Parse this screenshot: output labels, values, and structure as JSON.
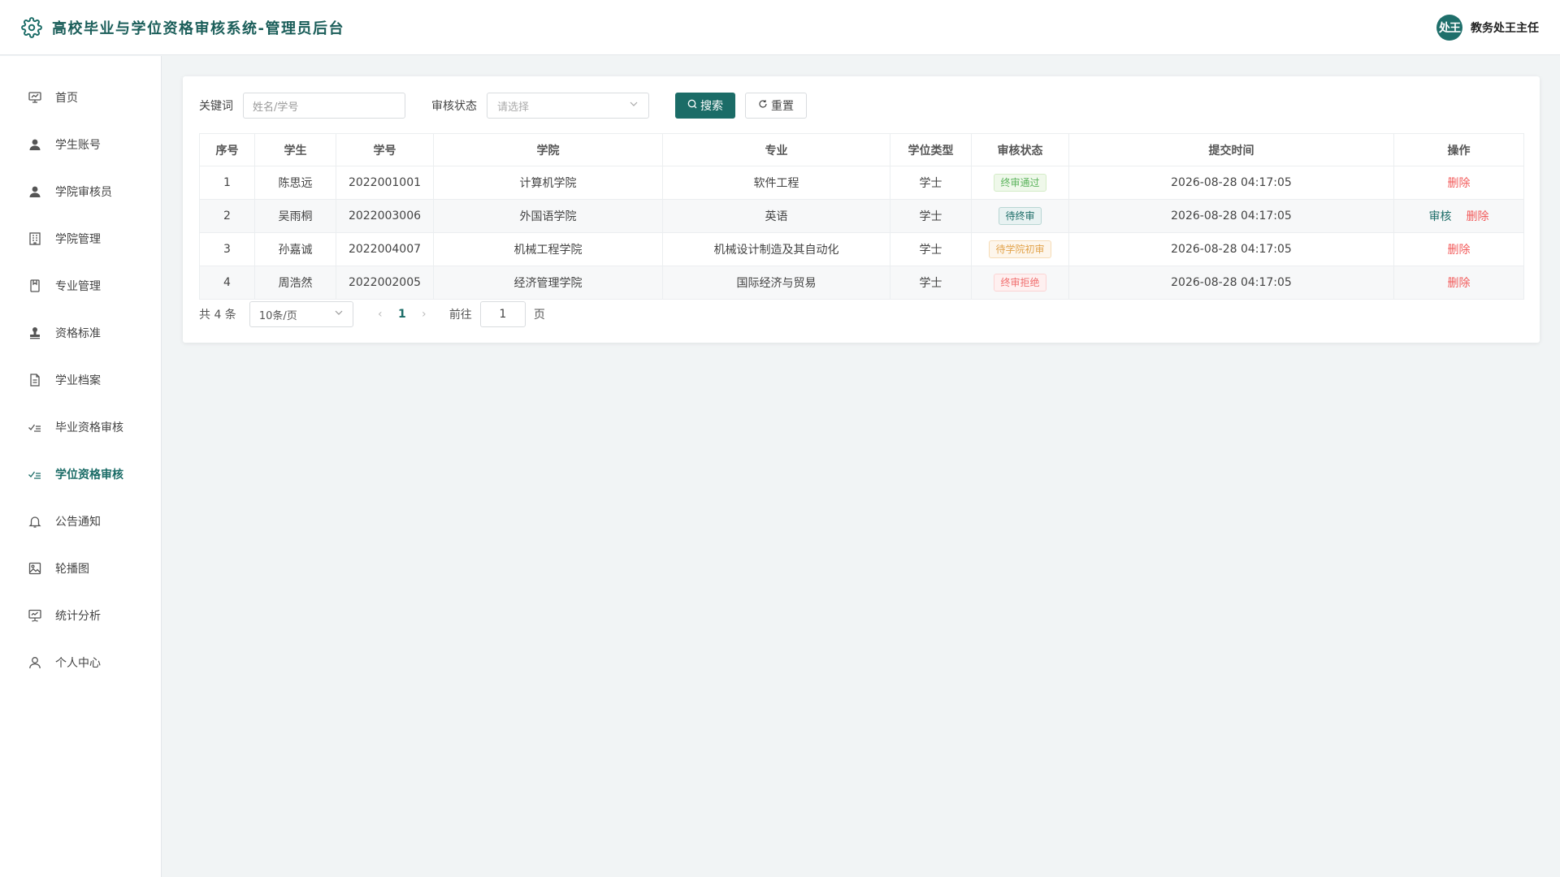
{
  "header": {
    "title": "高校毕业与学位资格审核系统-管理员后台",
    "avatar_text": "处王",
    "user_name": "教务处王主任"
  },
  "sidebar": {
    "items": [
      {
        "label": "首页",
        "icon": "monitor-icon"
      },
      {
        "label": "学生账号",
        "icon": "user-icon"
      },
      {
        "label": "学院审核员",
        "icon": "user-icon"
      },
      {
        "label": "学院管理",
        "icon": "building-icon"
      },
      {
        "label": "专业管理",
        "icon": "box-icon"
      },
      {
        "label": "资格标准",
        "icon": "stamp-icon"
      },
      {
        "label": "学业档案",
        "icon": "document-icon"
      },
      {
        "label": "毕业资格审核",
        "icon": "checklist-icon"
      },
      {
        "label": "学位资格审核",
        "icon": "checklist-icon",
        "active": true
      },
      {
        "label": "公告通知",
        "icon": "bell-icon"
      },
      {
        "label": "轮播图",
        "icon": "picture-icon"
      },
      {
        "label": "统计分析",
        "icon": "presentation-icon"
      },
      {
        "label": "个人中心",
        "icon": "user-outline-icon"
      }
    ]
  },
  "filters": {
    "keyword_label": "关键词",
    "keyword_placeholder": "姓名/学号",
    "status_label": "审核状态",
    "status_placeholder": "请选择",
    "search_label": "搜索",
    "reset_label": "重置"
  },
  "table": {
    "headers": [
      "序号",
      "学生",
      "学号",
      "学院",
      "专业",
      "学位类型",
      "审核状态",
      "提交时间",
      "操作"
    ],
    "rows": [
      {
        "index": "1",
        "student": "陈思远",
        "id": "2022001001",
        "college": "计算机学院",
        "major": "软件工程",
        "degree": "学士",
        "status": "终审通过",
        "status_color": "#5bb35c",
        "time": "2026-08-28 04:17:05",
        "review": "",
        "delete": "删除"
      },
      {
        "index": "2",
        "student": "吴雨桐",
        "id": "2022003006",
        "college": "外国语学院",
        "major": "英语",
        "degree": "学士",
        "status": "待终审",
        "status_color": "#1b6c67",
        "time": "2026-08-28 04:17:05",
        "review": "审核",
        "delete": "删除"
      },
      {
        "index": "3",
        "student": "孙嘉诚",
        "id": "2022004007",
        "college": "机械工程学院",
        "major": "机械设计制造及其自动化",
        "degree": "学士",
        "status": "待学院初审",
        "status_color": "#e2a34b",
        "time": "2026-08-28 04:17:05",
        "review": "",
        "delete": "删除"
      },
      {
        "index": "4",
        "student": "周浩然",
        "id": "2022002005",
        "college": "经济管理学院",
        "major": "国际经济与贸易",
        "degree": "学士",
        "status": "终审拒绝",
        "status_color": "#f06e6e",
        "time": "2026-08-28 04:17:05",
        "review": "",
        "delete": "删除"
      }
    ]
  },
  "pagination": {
    "total": "共 4 条",
    "page_size": "10条/页",
    "current": "1",
    "goto_label": "前往",
    "goto_value": "1",
    "page_suffix": "页"
  },
  "colors": {
    "accent": "#1b6c67",
    "danger": "#f25b5b"
  }
}
